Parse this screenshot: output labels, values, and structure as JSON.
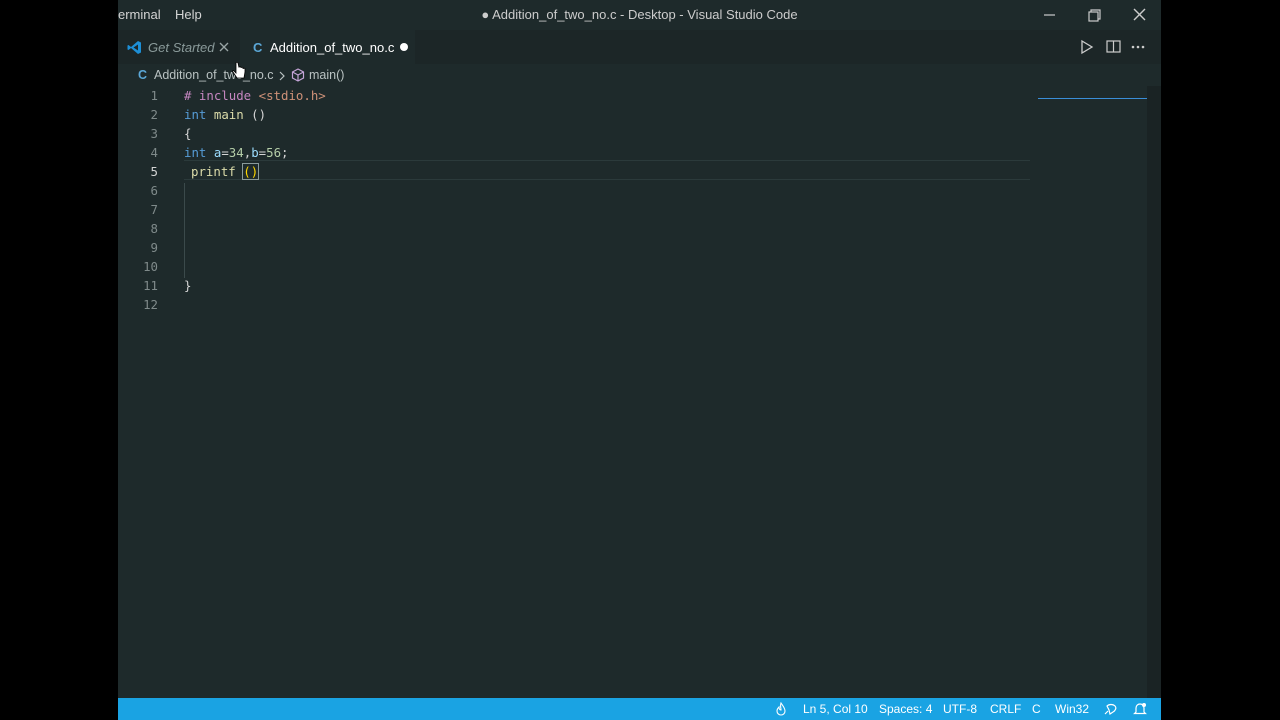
{
  "titlebar": {
    "menu": [
      "erminal",
      "Help"
    ],
    "title": "● Addition_of_two_no.c - Desktop - Visual Studio Code"
  },
  "tabs": [
    {
      "label": "Get Started",
      "icon": "vscode-icon"
    },
    {
      "label": "Addition_of_two_no.c",
      "icon": "c-file-icon",
      "icon_glyph": "C",
      "modified": true
    }
  ],
  "breadcrumb": {
    "file_icon": "C",
    "file": "Addition_of_two_no.c",
    "symbol": "main()"
  },
  "editor": {
    "line_numbers": [
      "1",
      "2",
      "3",
      "4",
      "5",
      "6",
      "7",
      "8",
      "9",
      "10",
      "11",
      "12"
    ],
    "lines": {
      "l1_pp": "# include",
      "l1_hdr": "<stdio.h>",
      "l2_kw": "int",
      "l2_fn": "main",
      "l2_rest": " ()",
      "l3": "{",
      "l4_kw": "int",
      "l4_a": "a",
      "l4_eq1": "=",
      "l4_n1": "34",
      "l4_comma": ",",
      "l4_b": "b",
      "l4_eq2": "=",
      "l4_n2": "56",
      "l4_semi": ";",
      "l5_fn": "printf",
      "l5_paren": "()",
      "l11": "}"
    }
  },
  "statusbar": {
    "position": "Ln 5, Col 10",
    "spaces": "Spaces: 4",
    "encoding": "UTF-8",
    "eol": "CRLF",
    "language": "C",
    "platform": "Win32"
  },
  "colors": {
    "background": "#1e2a2b",
    "statusbar": "#1aa3e3",
    "keyword": "#569cd6",
    "function": "#dcdcaa",
    "variable": "#9cdcfe",
    "number": "#b5cea8",
    "string": "#ce9178"
  }
}
